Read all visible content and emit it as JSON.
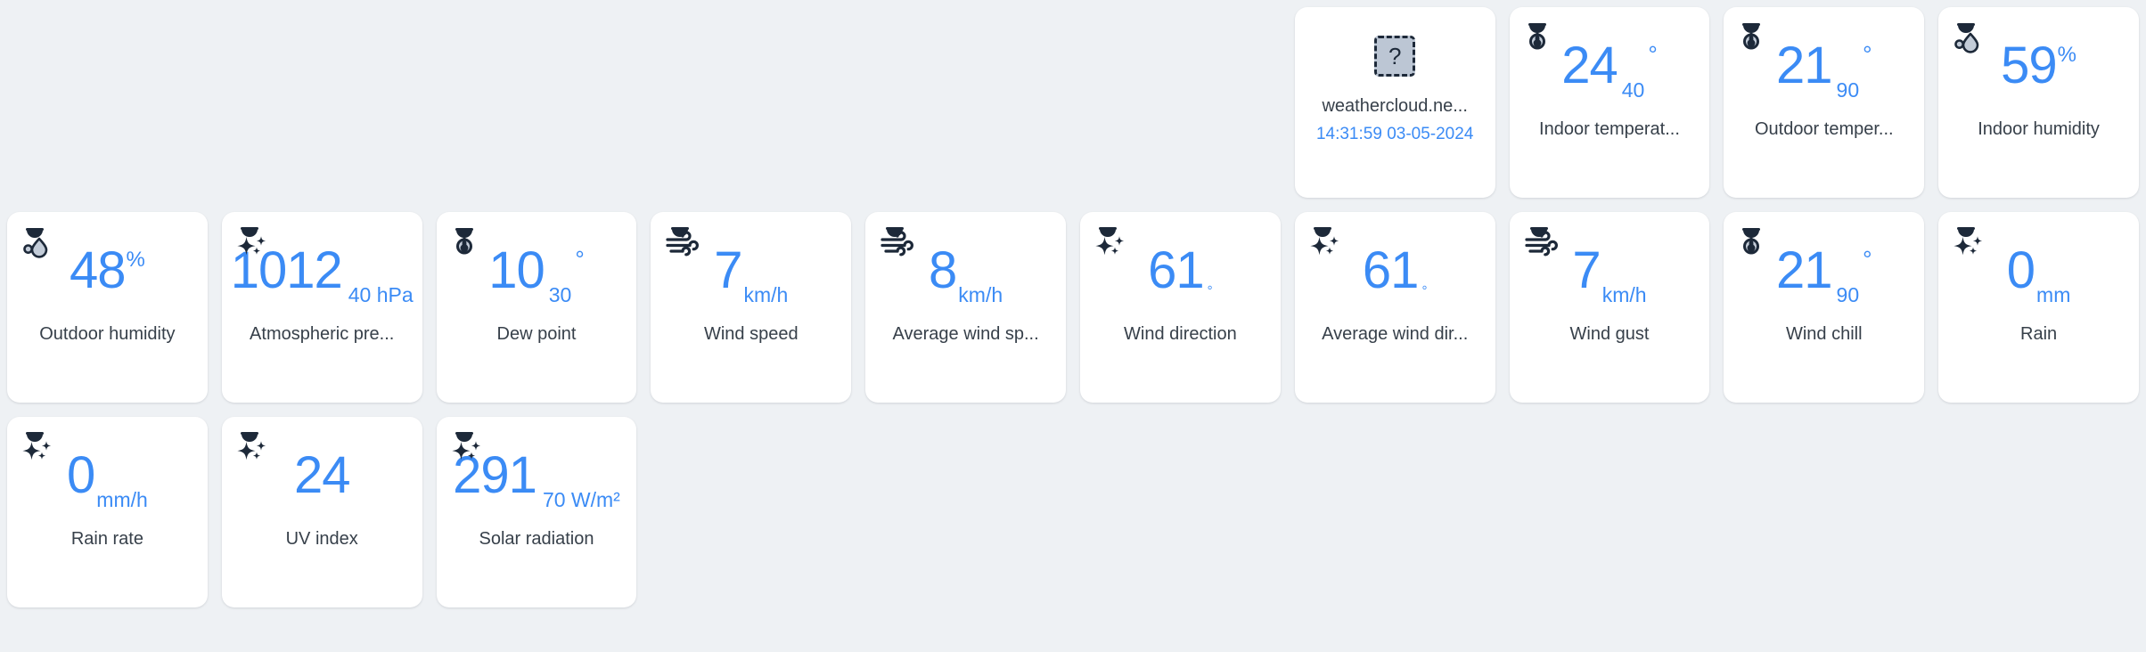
{
  "theme": {
    "page_background": "#eef1f4",
    "card_background": "#ffffff",
    "accent_blue": "#3b8bf5",
    "label_color": "#37404a",
    "icon_dark": "#1d2939",
    "icon_fill_light": "#c3ccd8"
  },
  "station": {
    "placeholder_glyph": "?",
    "name": "weathercloud.ne...",
    "timestamp": "14:31:59 03-05-2024"
  },
  "cards": [
    {
      "id": "indoor-temperature",
      "icon": "thermometer-icon",
      "value": "24",
      "suffix": "40",
      "suffix_kind": "dec",
      "degree": "°",
      "label": "Indoor temperat..."
    },
    {
      "id": "outdoor-temperature",
      "icon": "thermometer-icon",
      "value": "21",
      "suffix": "90",
      "suffix_kind": "dec",
      "degree": "°",
      "label": "Outdoor temper..."
    },
    {
      "id": "indoor-humidity",
      "icon": "droplet-icon",
      "value": "59",
      "suffix": "%",
      "suffix_kind": "pct",
      "label": "Indoor humidity"
    },
    {
      "id": "outdoor-humidity",
      "icon": "droplet-icon",
      "value": "48",
      "suffix": "%",
      "suffix_kind": "pct",
      "label": "Outdoor humidity"
    },
    {
      "id": "atmospheric-pressure",
      "icon": "sparkle-icon",
      "value": "1012",
      "suffix": "40 hPa",
      "suffix_kind": "unit-spaced",
      "label": "Atmospheric pre..."
    },
    {
      "id": "dew-point",
      "icon": "thermometer-icon",
      "value": "10",
      "suffix": "30",
      "suffix_kind": "dec",
      "degree": "°",
      "label": "Dew point"
    },
    {
      "id": "wind-speed",
      "icon": "wind-icon",
      "value": "7",
      "suffix": "km/h",
      "suffix_kind": "unit",
      "label": "Wind speed"
    },
    {
      "id": "average-wind-speed",
      "icon": "wind-icon",
      "value": "8",
      "suffix": "km/h",
      "suffix_kind": "unit",
      "label": "Average wind sp..."
    },
    {
      "id": "wind-direction",
      "icon": "sparkle-icon",
      "value": "61",
      "suffix": "°",
      "suffix_kind": "deg-small",
      "label": "Wind direction"
    },
    {
      "id": "average-wind-direction",
      "icon": "sparkle-icon",
      "value": "61",
      "suffix": "°",
      "suffix_kind": "deg-small",
      "label": "Average wind dir..."
    },
    {
      "id": "wind-gust",
      "icon": "wind-icon",
      "value": "7",
      "suffix": "km/h",
      "suffix_kind": "unit",
      "label": "Wind gust"
    },
    {
      "id": "wind-chill",
      "icon": "thermometer-icon",
      "value": "21",
      "suffix": "90",
      "suffix_kind": "dec",
      "degree": "°",
      "label": "Wind chill"
    },
    {
      "id": "rain",
      "icon": "sparkle-icon",
      "value": "0",
      "suffix": "mm",
      "suffix_kind": "unit",
      "label": "Rain"
    },
    {
      "id": "rain-rate",
      "icon": "sparkle-icon",
      "value": "0",
      "suffix": "mm/h",
      "suffix_kind": "unit",
      "label": "Rain rate"
    },
    {
      "id": "uv-index",
      "icon": "sparkle-icon",
      "value": "24",
      "suffix": "",
      "suffix_kind": "none",
      "label": "UV index"
    },
    {
      "id": "solar-radiation",
      "icon": "sparkle-icon",
      "value": "291",
      "suffix": "70 W/m²",
      "suffix_kind": "unit-spaced",
      "label": "Solar radiation"
    }
  ]
}
